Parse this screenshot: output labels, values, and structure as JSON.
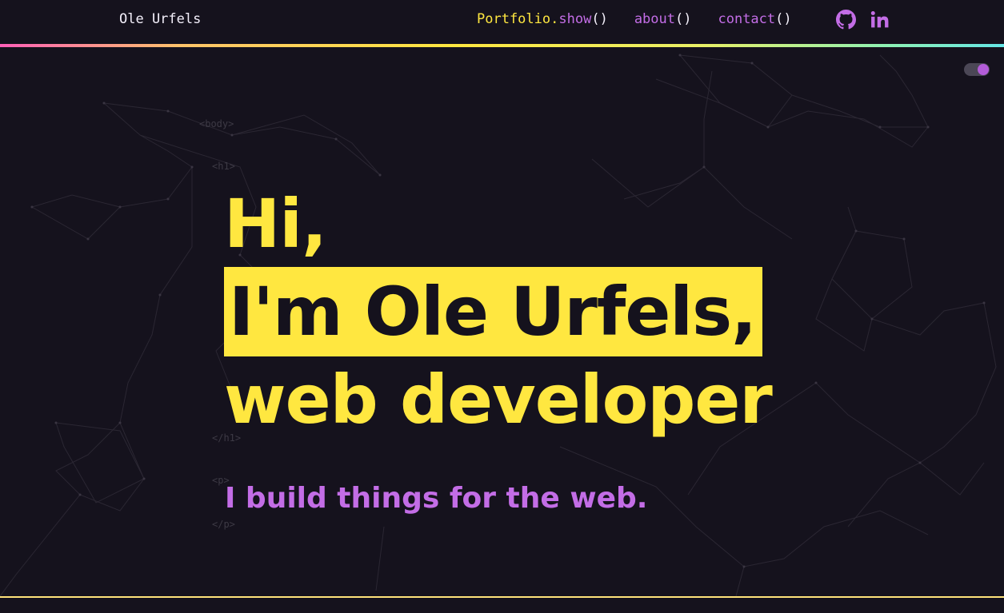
{
  "header": {
    "brand": "Ole Urfels",
    "nav": [
      {
        "object": "Portfolio",
        "dot": ".",
        "method": "show",
        "parens": "()"
      },
      {
        "object": "",
        "dot": "",
        "method": "about",
        "parens": "()"
      },
      {
        "object": "",
        "dot": "",
        "method": "contact",
        "parens": "()"
      }
    ],
    "social": [
      {
        "icon": "github-icon"
      },
      {
        "icon": "linkedin-icon"
      }
    ]
  },
  "theme_toggle": {
    "state": "on",
    "accent": "#b35cd9"
  },
  "code_tags": {
    "body_open": "<body>",
    "h1_open": "<h1>",
    "h1_close": "</h1>",
    "p_open": "<p>",
    "p_close": "</p>"
  },
  "hero": {
    "line1": "Hi,",
    "line2": "I'm Ole Urfels,",
    "line3": "web developer",
    "subtitle": "I build things for the web."
  },
  "colors": {
    "background": "#15121d",
    "accent_yellow": "#ffe740",
    "accent_purple": "#c36de6"
  }
}
